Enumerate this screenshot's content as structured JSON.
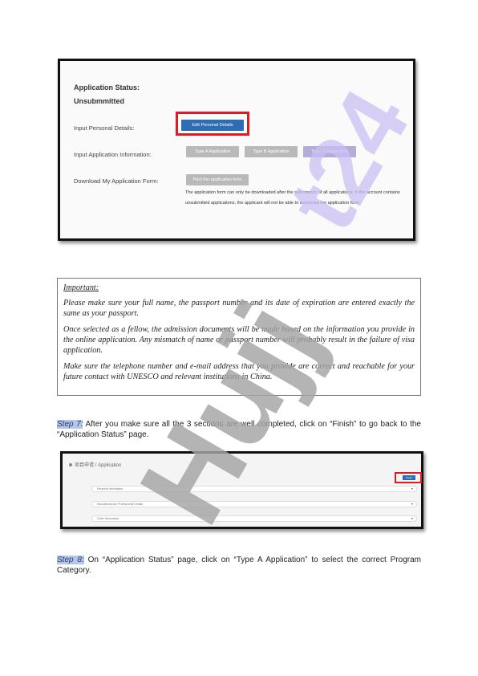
{
  "screenshot1": {
    "status_title_line1": "Application Status:",
    "status_title_line2": "Unsubmmitted",
    "personal_label": "Input Personal Details:",
    "edit_personal_button": "Edit Personal Details",
    "application_info_label": "Input Application Information:",
    "type_a_button": "Type A Application",
    "type_b_button": "Type B Application",
    "type_c_button": "Type C Application",
    "download_label": "Download My Application Form:",
    "print_button": "Print the application form",
    "note": "The application form can only be downloaded after the submission of all applications. If the account contains unsubmitted applications, the applicant will not be able to download the application form."
  },
  "important": {
    "heading": "Important:",
    "p1": "Please make sure your full name, the passport number and its date of expiration are entered exactly the same as your passport.",
    "p2": "Once selected as a fellow, the admission documents will be made based on the information you provide in the online application. Any mismatch of name or passport number will probably result in the failure of visa application.",
    "p3": "Make sure the telephone number and e-mail address that you provide are correct and reachable for your future contact with UNESCO and relevant institutions in China."
  },
  "step7": {
    "label": "Step 7:",
    "text": " After you make sure all the 3 sections are well completed, click on “Finish” to go back to the “Application Status” page."
  },
  "screenshot2": {
    "header": "项目申请 / Application",
    "finish_button": "Finish",
    "row1": "Personal Information",
    "row2": "Educational and Professional Details",
    "row3": "Other Information"
  },
  "step8": {
    "label": "Step 8:",
    "text": " On “Application Status” page, click on “Type A Application” to select the correct Program Category."
  },
  "watermark": {
    "gray_text": "Hujj",
    "purple_text": "t24",
    "gray_color": "#a3a3a3",
    "purple_color": "#c9bff2"
  }
}
